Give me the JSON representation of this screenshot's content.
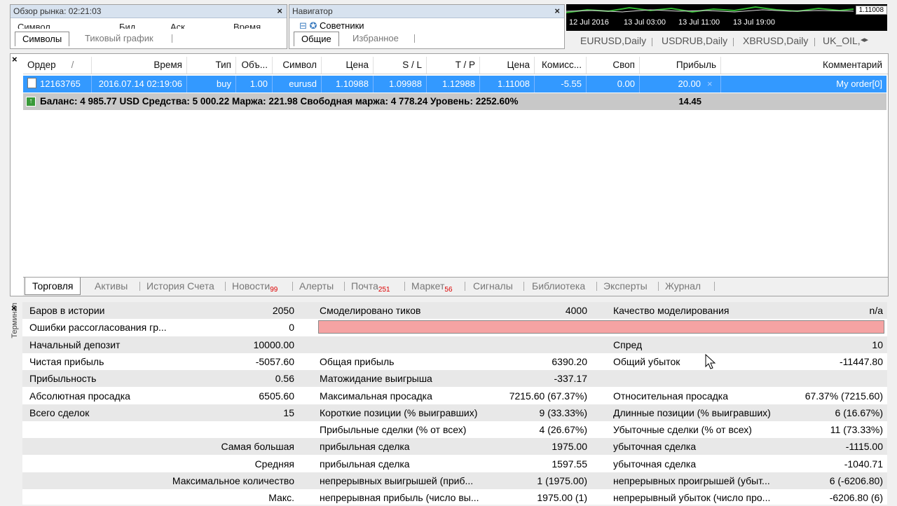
{
  "market_watch": {
    "title": "Обзор рынка: 02:21:03",
    "cols": [
      "Символ",
      "Бид",
      "Аск",
      "Время"
    ],
    "tabs": [
      "Символы",
      "Тиковый график"
    ]
  },
  "navigator": {
    "title": "Навигатор",
    "tree_item": "Советники",
    "tabs": [
      "Общие",
      "Избранное"
    ]
  },
  "chart": {
    "price": "1.11008",
    "dates": [
      "12 Jul 2016",
      "13 Jul 03:00",
      "13 Jul 11:00",
      "13 Jul 19:00"
    ],
    "tabs": [
      "EURUSD,Daily",
      "USDRUB,Daily",
      "XBRUSD,Daily",
      "UK_OIL,"
    ]
  },
  "terminal": {
    "label": "Терминал",
    "headers": [
      "Ордер",
      "Время",
      "Тип",
      "Объ...",
      "Символ",
      "Цена",
      "S / L",
      "T / P",
      "Цена",
      "Комисс...",
      "Своп",
      "Прибыль",
      "Комментарий"
    ],
    "sort_arrow": "/",
    "order": {
      "id": "12163765",
      "time": "2016.07.14 02:19:06",
      "type": "buy",
      "volume": "1.00",
      "symbol": "eurusd",
      "price": "1.10988",
      "sl": "1.09988",
      "tp": "1.12988",
      "cur_price": "1.11008",
      "commission": "-5.55",
      "swap": "0.00",
      "profit": "20.00",
      "comment": "My order[0]"
    },
    "balance_line": "Баланс: 4 985.77 USD  Средства: 5 000.22  Маржа: 221.98  Свободная маржа: 4 778.24  Уровень: 2252.60%",
    "balance_profit": "14.45",
    "tabs": [
      {
        "label": "Торговля",
        "badge": ""
      },
      {
        "label": "Активы",
        "badge": ""
      },
      {
        "label": "История Счета",
        "badge": ""
      },
      {
        "label": "Новости",
        "badge": "99"
      },
      {
        "label": "Алерты",
        "badge": ""
      },
      {
        "label": "Почта",
        "badge": "251"
      },
      {
        "label": "Маркет",
        "badge": "56"
      },
      {
        "label": "Сигналы",
        "badge": ""
      },
      {
        "label": "Библиотека",
        "badge": ""
      },
      {
        "label": "Эксперты",
        "badge": ""
      },
      {
        "label": "Журнал",
        "badge": ""
      }
    ]
  },
  "report": {
    "rows": [
      [
        "Баров в истории",
        "2050",
        "Смоделировано тиков",
        "4000",
        "Качество моделирования",
        "n/a"
      ],
      [
        "Ошибки рассогласования гр...",
        "0",
        "",
        "",
        "",
        ""
      ],
      [
        "Начальный депозит",
        "10000.00",
        "",
        "",
        "Спред",
        "10"
      ],
      [
        "Чистая прибыль",
        "-5057.60",
        "Общая прибыль",
        "6390.20",
        "Общий убыток",
        "-11447.80"
      ],
      [
        "Прибыльность",
        "0.56",
        "Матожидание выигрыша",
        "-337.17",
        "",
        ""
      ],
      [
        "Абсолютная просадка",
        "6505.60",
        "Максимальная просадка",
        "7215.60 (67.37%)",
        "Относительная просадка",
        "67.37% (7215.60)"
      ],
      [
        "Всего сделок",
        "15",
        "Короткие позиции (% выигравших)",
        "9 (33.33%)",
        "Длинные позиции (% выигравших)",
        "6 (16.67%)"
      ],
      [
        "",
        "",
        "Прибыльные сделки (% от всех)",
        "4 (26.67%)",
        "Убыточные сделки (% от всех)",
        "11 (73.33%)"
      ],
      [
        "Самая большая",
        "",
        "прибыльная сделка",
        "1975.00",
        "убыточная сделка",
        "-1115.00"
      ],
      [
        "Средняя",
        "",
        "прибыльная сделка",
        "1597.55",
        "убыточная сделка",
        "-1040.71"
      ],
      [
        "Максимальное количество",
        "",
        "непрерывных выигрышей (приб...",
        "1 (1975.00)",
        "непрерывных проигрышей (убыт...",
        "6 (-6206.80)"
      ],
      [
        "Макс.",
        "",
        "непрерывная прибыль (число вы...",
        "1975.00 (1)",
        "непрерывный убыток (число про...",
        "-6206.80 (6)"
      ]
    ]
  }
}
